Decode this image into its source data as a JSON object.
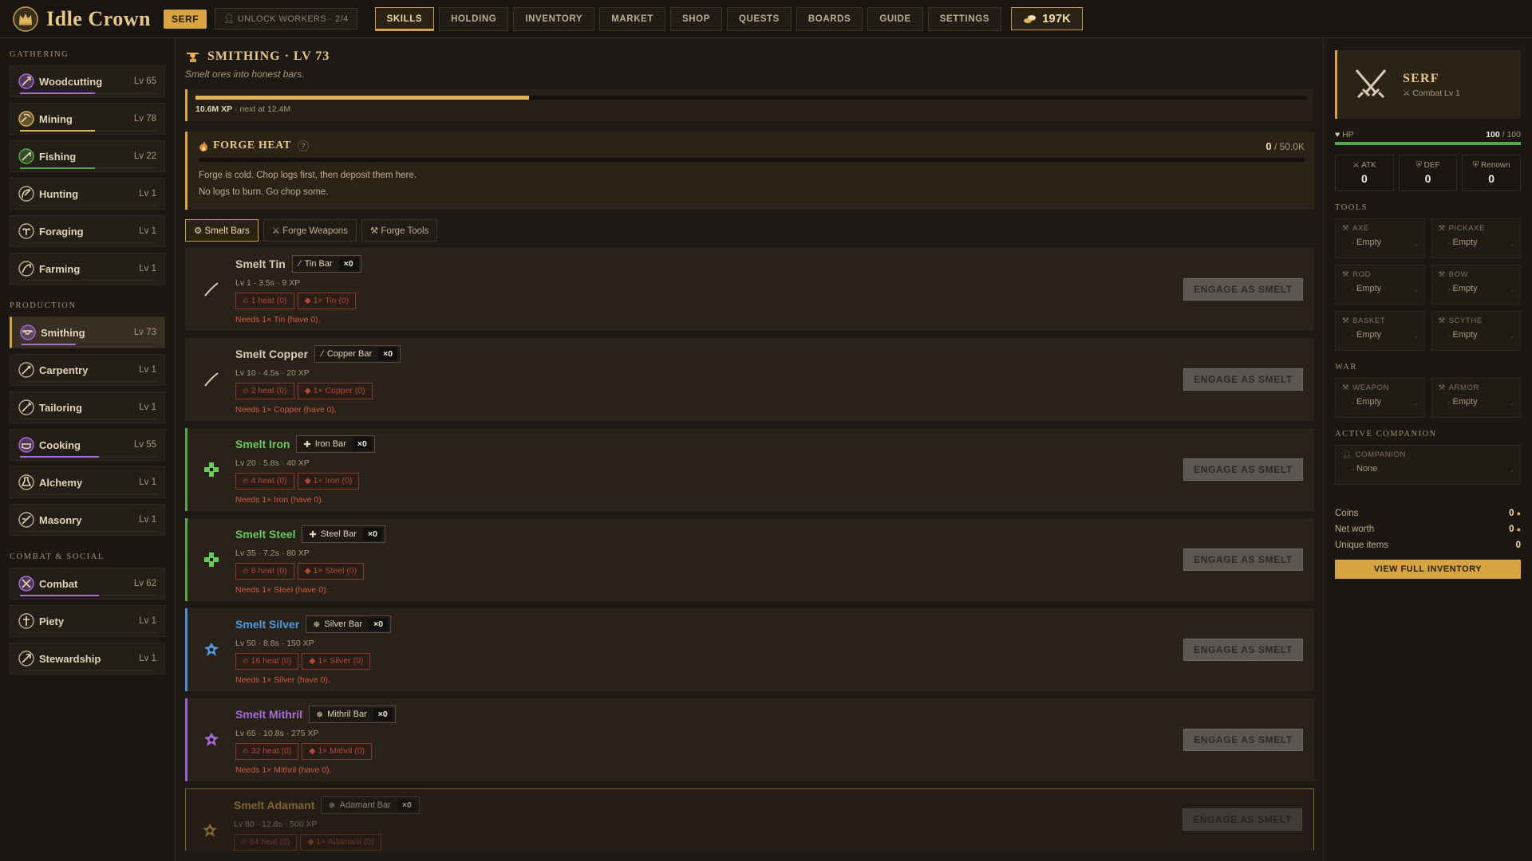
{
  "app": {
    "title": "Idle Crown",
    "rank_badge": "SERF",
    "unlock_workers": "UNLOCK WORKERS · 2/4",
    "coins_display": "197K"
  },
  "nav": {
    "tabs": [
      {
        "label": "SKILLS",
        "active": true
      },
      {
        "label": "HOLDING"
      },
      {
        "label": "INVENTORY"
      },
      {
        "label": "MARKET"
      },
      {
        "label": "SHOP"
      },
      {
        "label": "QUESTS"
      },
      {
        "label": "BOARDS"
      },
      {
        "label": "GUIDE"
      },
      {
        "label": "SETTINGS"
      }
    ]
  },
  "sidebar": {
    "groups": [
      {
        "heading": "GATHERING",
        "items": [
          {
            "name": "Woodcutting",
            "level": "Lv 65",
            "progress": 0.55,
            "color": "#a66cd8"
          },
          {
            "name": "Mining",
            "level": "Lv 78",
            "progress": 0.55,
            "color": "#e0b45a"
          },
          {
            "name": "Fishing",
            "level": "Lv 22",
            "progress": 0.55,
            "color": "#56a84a"
          },
          {
            "name": "Hunting",
            "level": "Lv 1",
            "progress": 0,
            "color": "#e0b45a"
          },
          {
            "name": "Foraging",
            "level": "Lv 1",
            "progress": 0,
            "color": "#e0b45a"
          },
          {
            "name": "Farming",
            "level": "Lv 1",
            "progress": 0,
            "color": "#e0b45a"
          }
        ]
      },
      {
        "heading": "PRODUCTION",
        "items": [
          {
            "name": "Smithing",
            "level": "Lv 73",
            "progress": 0.4,
            "color": "#a66cd8",
            "active": true
          },
          {
            "name": "Carpentry",
            "level": "Lv 1",
            "progress": 0,
            "color": "#e0b45a"
          },
          {
            "name": "Tailoring",
            "level": "Lv 1",
            "progress": 0,
            "color": "#e0b45a"
          },
          {
            "name": "Cooking",
            "level": "Lv 55",
            "progress": 0.58,
            "color": "#a66cd8"
          },
          {
            "name": "Alchemy",
            "level": "Lv 1",
            "progress": 0,
            "color": "#e0b45a"
          },
          {
            "name": "Masonry",
            "level": "Lv 1",
            "progress": 0,
            "color": "#e0b45a"
          }
        ]
      },
      {
        "heading": "COMBAT & SOCIAL",
        "items": [
          {
            "name": "Combat",
            "level": "Lv 62",
            "progress": 0.58,
            "color": "#a66cd8"
          },
          {
            "name": "Piety",
            "level": "Lv 1",
            "progress": 0,
            "color": "#e0b45a"
          },
          {
            "name": "Stewardship",
            "level": "Lv 1",
            "progress": 0,
            "color": "#e0b45a"
          }
        ]
      }
    ]
  },
  "main": {
    "title": "SMITHING · LV 73",
    "subtitle": "Smelt ores into honest bars.",
    "xp_text": "10.6M XP",
    "xp_next": " · next at 12.4M",
    "xp_progress": 0.3,
    "forge": {
      "title": "FORGE HEAT",
      "help": "?",
      "value": "0",
      "max": " / 50.0K",
      "msg1": "Forge is cold. Chop logs first, then deposit them here.",
      "msg2": "No logs to burn. Go chop some."
    },
    "sub_tabs": [
      {
        "label": "Smelt Bars",
        "icon": "⚙",
        "active": true
      },
      {
        "label": "Forge Weapons",
        "icon": "⚔"
      },
      {
        "label": "Forge Tools",
        "icon": "⚒"
      }
    ],
    "engage_label": "ENGAGE AS SMELT",
    "recipes": [
      {
        "name": "Smelt Tin",
        "bar": "Tin Bar",
        "qty": "×0",
        "meta": "Lv 1 · 3.5s · 9 XP",
        "heat": "1 heat (0)",
        "ore": "1× Tin (0)",
        "need": "Needs 1× Tin (have 0).",
        "color": "#d9cbb2",
        "accent": "",
        "icon": "ingot-icon"
      },
      {
        "name": "Smelt Copper",
        "bar": "Copper Bar",
        "qty": "×0",
        "meta": "Lv 10 · 4.5s · 20 XP",
        "heat": "2 heat (0)",
        "ore": "1× Copper (0)",
        "need": "Needs 1× Copper (have 0).",
        "color": "#d9cbb2",
        "accent": "",
        "icon": "ingot-icon"
      },
      {
        "name": "Smelt Iron",
        "bar": "Iron Bar",
        "qty": "×0",
        "meta": "Lv 20 · 5.8s · 40 XP",
        "heat": "4 heat (0)",
        "ore": "1× Iron (0)",
        "need": "Needs 1× Iron (have 0).",
        "color": "#69c95a",
        "accent": "#56a84a",
        "icon": "cross-icon"
      },
      {
        "name": "Smelt Steel",
        "bar": "Steel Bar",
        "qty": "×0",
        "meta": "Lv 35 · 7.2s · 80 XP",
        "heat": "8 heat (0)",
        "ore": "1× Steel (0)",
        "need": "Needs 1× Steel (have 0).",
        "color": "#69c95a",
        "accent": "#56a84a",
        "icon": "cross-icon"
      },
      {
        "name": "Smelt Silver",
        "bar": "Silver Bar",
        "qty": "×0",
        "meta": "Lv 50 · 8.8s · 150 XP",
        "heat": "16 heat (0)",
        "ore": "1× Silver (0)",
        "need": "Needs 1× Silver (have 0).",
        "color": "#4f9be0",
        "accent": "#4f8fd0",
        "icon": "gem-icon"
      },
      {
        "name": "Smelt Mithril",
        "bar": "Mithril Bar",
        "qty": "×0",
        "meta": "Lv 65 · 10.8s · 275 XP",
        "heat": "32 heat (0)",
        "ore": "1× Mithril (0)",
        "need": "Needs 1× Mithril (have 0).",
        "color": "#a66cd8",
        "accent": "#9a5fd0",
        "icon": "gem-icon"
      },
      {
        "name": "Smelt Adamant",
        "bar": "Adamant Bar",
        "qty": "×0",
        "meta": "Lv 80 · 12.8s · 500 XP",
        "heat": "64 heat (0)",
        "ore": "1× Adamant (0)",
        "need": "",
        "color": "#c9a04a",
        "accent": "",
        "icon": "gem-icon",
        "dim": true
      }
    ]
  },
  "character": {
    "name": "SERF",
    "sub": "Combat Lv 1",
    "hp_label": "HP",
    "hp_value": "100",
    "hp_max": " / 100",
    "hp_fraction": 1.0,
    "stats": [
      {
        "label": "ATK",
        "value": "0"
      },
      {
        "label": "DEF",
        "value": "0"
      },
      {
        "label": "Renown",
        "value": "0"
      }
    ],
    "tools_heading": "TOOLS",
    "tools": [
      {
        "label": "AXE",
        "value": "Empty"
      },
      {
        "label": "PICKAXE",
        "value": "Empty"
      },
      {
        "label": "ROD",
        "value": "Empty"
      },
      {
        "label": "BOW",
        "value": "Empty"
      },
      {
        "label": "BASKET",
        "value": "Empty"
      },
      {
        "label": "SCYTHE",
        "value": "Empty"
      }
    ],
    "war_heading": "WAR",
    "war": [
      {
        "label": "WEAPON",
        "value": "Empty"
      },
      {
        "label": "ARMOR",
        "value": "Empty"
      }
    ],
    "companion_heading": "ACTIVE COMPANION",
    "companion_label": "COMPANION",
    "companion_value": "None",
    "wealth": [
      {
        "label": "Coins",
        "value": "0",
        "coin": true
      },
      {
        "label": "Net worth",
        "value": "0",
        "coin": true
      },
      {
        "label": "Unique items",
        "value": "0",
        "coin": false
      }
    ],
    "view_inventory": "VIEW FULL INVENTORY"
  }
}
